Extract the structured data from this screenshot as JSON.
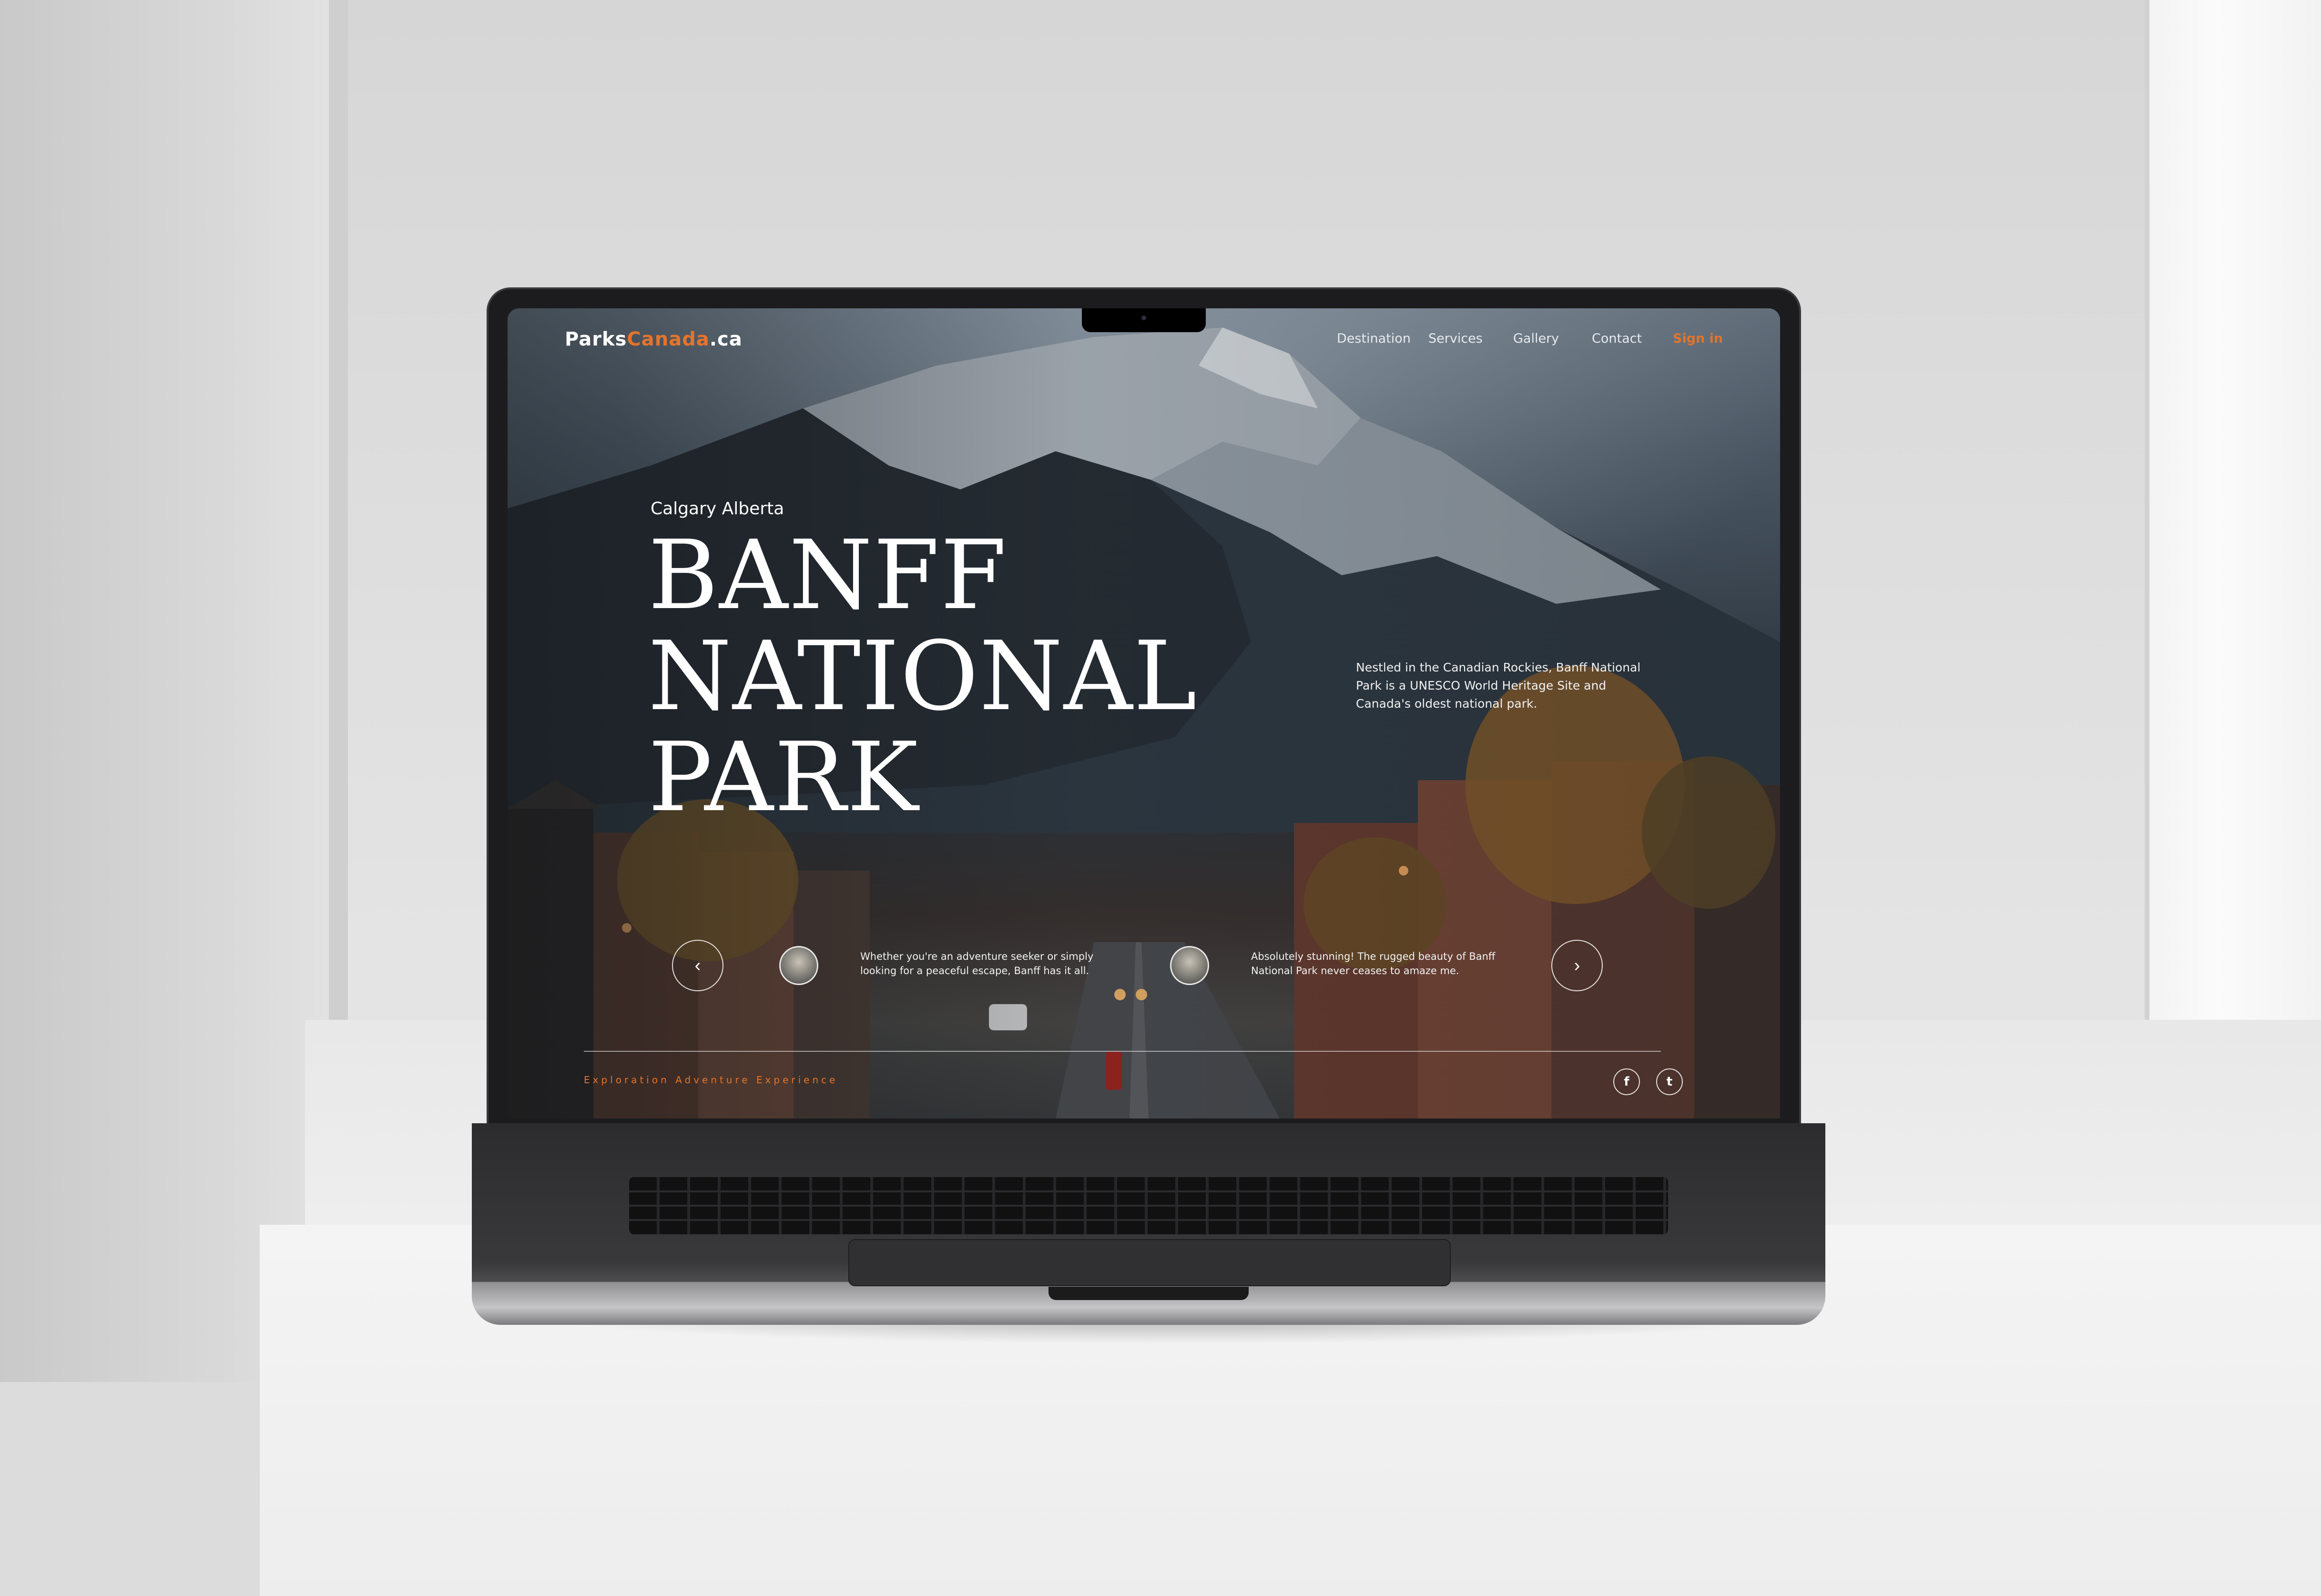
{
  "site": {
    "logo_prefix": "Parks",
    "logo_accent": "Canada",
    "logo_suffix": ".ca",
    "accent_color": "#e4742b"
  },
  "nav": {
    "items": [
      {
        "label": "Destination"
      },
      {
        "label": "Services"
      },
      {
        "label": "Gallery"
      },
      {
        "label": "Contact"
      }
    ],
    "signin_label": "Sign in"
  },
  "hero": {
    "location": "Calgary  Alberta",
    "title_lines": [
      "BANFF",
      "NATIONAL",
      "PARK"
    ],
    "description": "Nestled in the Canadian Rockies, Banff National Park is a UNESCO World Heritage Site and Canada's oldest national park."
  },
  "carousel": {
    "prev_icon": "chevron-left-icon",
    "prev_glyph": "‹",
    "next_icon": "chevron-right-icon",
    "next_glyph": "›",
    "testimonials": [
      {
        "text": "Whether you're an adventure seeker or simply looking for a peaceful escape, Banff has it all."
      },
      {
        "text": "Absolutely stunning! The rugged beauty of Banff National Park never ceases to amaze me."
      }
    ]
  },
  "footer": {
    "tagline": "Exploration Adventure Experience",
    "social": [
      {
        "icon": "facebook-icon",
        "glyph": "f"
      },
      {
        "icon": "twitter-icon",
        "glyph": "t"
      }
    ]
  }
}
